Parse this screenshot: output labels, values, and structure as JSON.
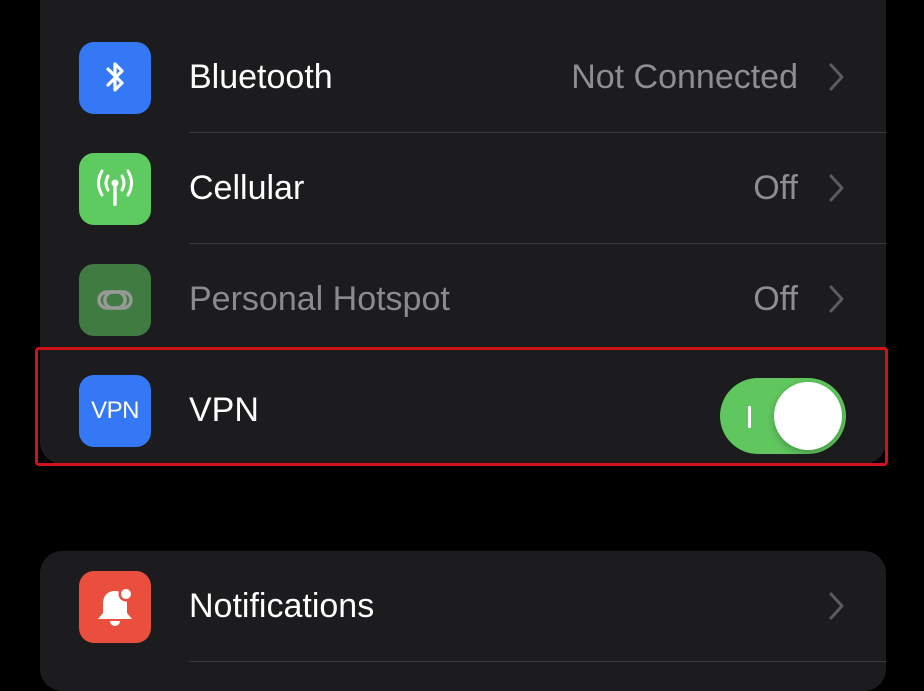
{
  "colors": {
    "background": "#000000",
    "group_background": "#1c1c1e",
    "separator": "#3a3a3c",
    "secondary_text": "#8d8d92",
    "bluetooth_icon_bg": "#3478f6",
    "cellular_icon_bg": "#5ecb60",
    "hotspot_icon_bg": "#5ecb60",
    "vpn_icon_bg": "#3478f6",
    "notifications_icon_bg": "#ea4e3d",
    "toggle_on": "#60c75e",
    "highlight": "#d0121b"
  },
  "settings": {
    "connectivity_group": [
      {
        "id": "bluetooth",
        "label": "Bluetooth",
        "value": "Not Connected",
        "icon": "bluetooth-icon"
      },
      {
        "id": "cellular",
        "label": "Cellular",
        "value": "Off",
        "icon": "antenna-icon"
      },
      {
        "id": "personal_hotspot",
        "label": "Personal Hotspot",
        "value": "Off",
        "icon": "link-chain-icon",
        "disabled": true
      },
      {
        "id": "vpn",
        "label": "VPN",
        "icon_text": "VPN",
        "icon": "vpn-icon",
        "toggle_on": true,
        "highlighted": true
      }
    ],
    "notifications_group": [
      {
        "id": "notifications",
        "label": "Notifications",
        "icon": "bell-icon"
      }
    ]
  }
}
